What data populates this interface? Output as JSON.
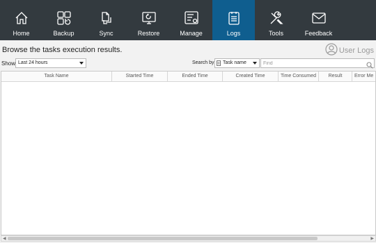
{
  "nav": {
    "items": [
      {
        "label": "Home",
        "icon": "home-icon"
      },
      {
        "label": "Backup",
        "icon": "backup-icon"
      },
      {
        "label": "Sync",
        "icon": "sync-icon"
      },
      {
        "label": "Restore",
        "icon": "restore-icon"
      },
      {
        "label": "Manage",
        "icon": "manage-icon"
      },
      {
        "label": "Logs",
        "icon": "logs-icon"
      },
      {
        "label": "Tools",
        "icon": "tools-icon"
      },
      {
        "label": "Feedback",
        "icon": "feedback-icon"
      }
    ],
    "active": "Logs"
  },
  "header": {
    "title": "Browse the tasks execution results.",
    "user_logs_label": "User Logs"
  },
  "filter": {
    "show_label": "Show",
    "range_value": "Last 24 hours",
    "search_by_label": "Search by:",
    "field_value": "Task name",
    "find_placeholder": "Find"
  },
  "table": {
    "columns": [
      "Task Name",
      "Started Time",
      "Ended Time",
      "Created Time",
      "Time Consumed",
      "Result",
      "Error Me"
    ],
    "rows": []
  },
  "colors": {
    "topbar": "#333a3f",
    "active_tab": "#0f5e8f"
  }
}
